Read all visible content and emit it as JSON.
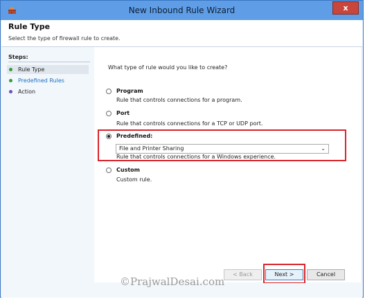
{
  "window": {
    "title": "New Inbound Rule Wizard",
    "close_label": "x"
  },
  "header": {
    "title": "Rule Type",
    "description": "Select the type of firewall rule to create."
  },
  "steps": {
    "label": "Steps:",
    "items": [
      {
        "label": "Rule Type",
        "state": "current",
        "color": "#3a9b3a"
      },
      {
        "label": "Predefined Rules",
        "state": "done",
        "color": "#3a9b3a"
      },
      {
        "label": "Action",
        "state": "pending",
        "color": "#6a4fb8"
      }
    ]
  },
  "main": {
    "question": "What type of rule would you like to create?",
    "options": [
      {
        "title": "Program",
        "description": "Rule that controls connections for a program.",
        "checked": false
      },
      {
        "title": "Port",
        "description": "Rule that controls connections for a TCP or UDP port.",
        "checked": false
      },
      {
        "title": "Predefined:",
        "description": "Rule that controls connections for a Windows experience.",
        "checked": true
      },
      {
        "title": "Custom",
        "description": "Custom rule.",
        "checked": false
      }
    ],
    "predefined_select": {
      "value": "File and Printer Sharing"
    }
  },
  "buttons": {
    "back": "< Back",
    "next": "Next >",
    "cancel": "Cancel"
  },
  "watermark": "©PrajwalDesai.com",
  "colors": {
    "titlebar": "#5f9ee6",
    "close": "#c9463d",
    "highlight": "#d8232a"
  }
}
